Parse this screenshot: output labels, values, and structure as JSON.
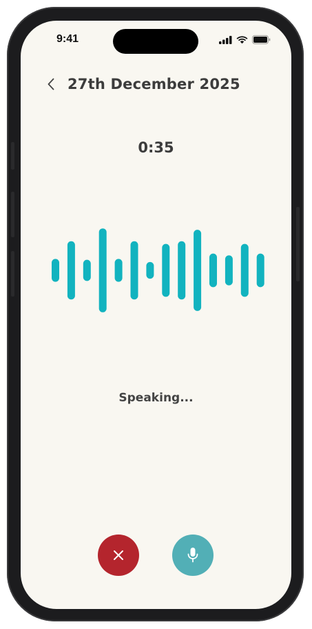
{
  "status_bar": {
    "time": "9:41"
  },
  "header": {
    "title": "27th December 2025"
  },
  "recording": {
    "timer": "0:35",
    "status_text": "Speaking...",
    "waveform_bar_levels": [
      0.26,
      0.66,
      0.24,
      0.95,
      0.26,
      0.66,
      0.19,
      0.6,
      0.66,
      0.92,
      0.38,
      0.34,
      0.6,
      0.38
    ]
  },
  "actions": {
    "cancel_icon": "close-icon",
    "mic_icon": "microphone-icon"
  },
  "colors": {
    "screen_background": "#f9f7f1",
    "waveform": "#12b3bf",
    "cancel_button": "#b4252d",
    "mic_button": "#52afb6",
    "text": "#3c3c3c"
  }
}
